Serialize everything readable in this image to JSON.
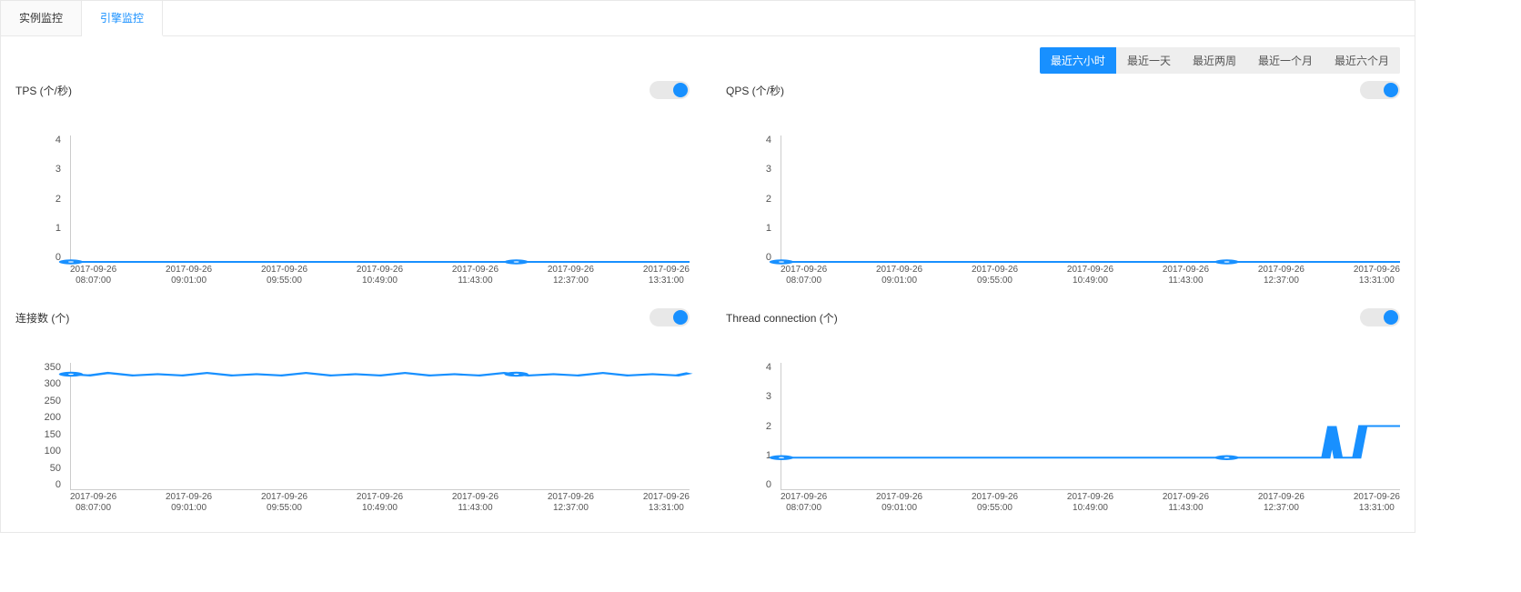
{
  "tabs": {
    "instance": "实例监控",
    "engine": "引擎监控"
  },
  "time_ranges": {
    "h6": "最近六小时",
    "d1": "最近一天",
    "w2": "最近两周",
    "m1": "最近一个月",
    "m6": "最近六个月"
  },
  "x_ticks": [
    {
      "date": "2017-09-26",
      "time": "08:07:00"
    },
    {
      "date": "2017-09-26",
      "time": "09:01:00"
    },
    {
      "date": "2017-09-26",
      "time": "09:55:00"
    },
    {
      "date": "2017-09-26",
      "time": "10:49:00"
    },
    {
      "date": "2017-09-26",
      "time": "11:43:00"
    },
    {
      "date": "2017-09-26",
      "time": "12:37:00"
    },
    {
      "date": "2017-09-26",
      "time": "13:31:00"
    }
  ],
  "charts": {
    "tps": {
      "title": "TPS (个/秒)",
      "y_ticks": [
        "4",
        "3",
        "2",
        "1",
        "0"
      ]
    },
    "qps": {
      "title": "QPS (个/秒)",
      "y_ticks": [
        "4",
        "3",
        "2",
        "1",
        "0"
      ]
    },
    "conn": {
      "title": "连接数 (个)",
      "y_ticks": [
        "350",
        "300",
        "250",
        "200",
        "150",
        "100",
        "50",
        "0"
      ]
    },
    "thr": {
      "title": "Thread connection (个)",
      "y_ticks": [
        "4",
        "3",
        "2",
        "1",
        "0"
      ]
    }
  },
  "chart_data": [
    {
      "id": "tps",
      "type": "line",
      "title": "TPS (个/秒)",
      "xlabel": "",
      "ylabel": "",
      "ylim": [
        0,
        4
      ],
      "categories": [
        "2017-09-26 08:07:00",
        "2017-09-26 09:01:00",
        "2017-09-26 09:55:00",
        "2017-09-26 10:49:00",
        "2017-09-26 11:43:00",
        "2017-09-26 12:37:00",
        "2017-09-26 13:31:00"
      ],
      "series": [
        {
          "name": "TPS",
          "values": [
            0,
            0,
            0,
            0,
            0,
            0,
            0
          ]
        }
      ],
      "markers_x": [
        0,
        4.5
      ]
    },
    {
      "id": "qps",
      "type": "line",
      "title": "QPS (个/秒)",
      "xlabel": "",
      "ylabel": "",
      "ylim": [
        0,
        4
      ],
      "categories": [
        "2017-09-26 08:07:00",
        "2017-09-26 09:01:00",
        "2017-09-26 09:55:00",
        "2017-09-26 10:49:00",
        "2017-09-26 11:43:00",
        "2017-09-26 12:37:00",
        "2017-09-26 13:31:00"
      ],
      "series": [
        {
          "name": "QPS",
          "values": [
            0,
            0,
            0,
            0,
            0,
            0,
            0
          ]
        }
      ],
      "markers_x": [
        0,
        4.5
      ]
    },
    {
      "id": "conn",
      "type": "line",
      "title": "连接数 (个)",
      "xlabel": "",
      "ylabel": "",
      "ylim": [
        0,
        350
      ],
      "categories": [
        "2017-09-26 08:07:00",
        "2017-09-26 09:01:00",
        "2017-09-26 09:55:00",
        "2017-09-26 10:49:00",
        "2017-09-26 11:43:00",
        "2017-09-26 12:37:00",
        "2017-09-26 13:31:00"
      ],
      "series": [
        {
          "name": "连接数",
          "values": [
            320,
            320,
            320,
            320,
            320,
            320,
            320
          ]
        }
      ],
      "markers_x": [
        0,
        4.5
      ]
    },
    {
      "id": "thr",
      "type": "line",
      "title": "Thread connection (个)",
      "xlabel": "",
      "ylabel": "",
      "ylim": [
        0,
        4
      ],
      "categories": [
        "2017-09-26 08:07:00",
        "2017-09-26 09:01:00",
        "2017-09-26 09:55:00",
        "2017-09-26 10:49:00",
        "2017-09-26 11:43:00",
        "2017-09-26 12:37:00",
        "2017-09-26 13:31:00"
      ],
      "series": [
        {
          "name": "Thread connection",
          "values": [
            1,
            1,
            1,
            1,
            1,
            1,
            1
          ]
        }
      ],
      "markers_x": [
        0,
        4.5
      ],
      "spikes": [
        {
          "approx_x": 5.7,
          "to": 2
        },
        {
          "approx_x": 6.0,
          "to": 2
        }
      ]
    }
  ]
}
